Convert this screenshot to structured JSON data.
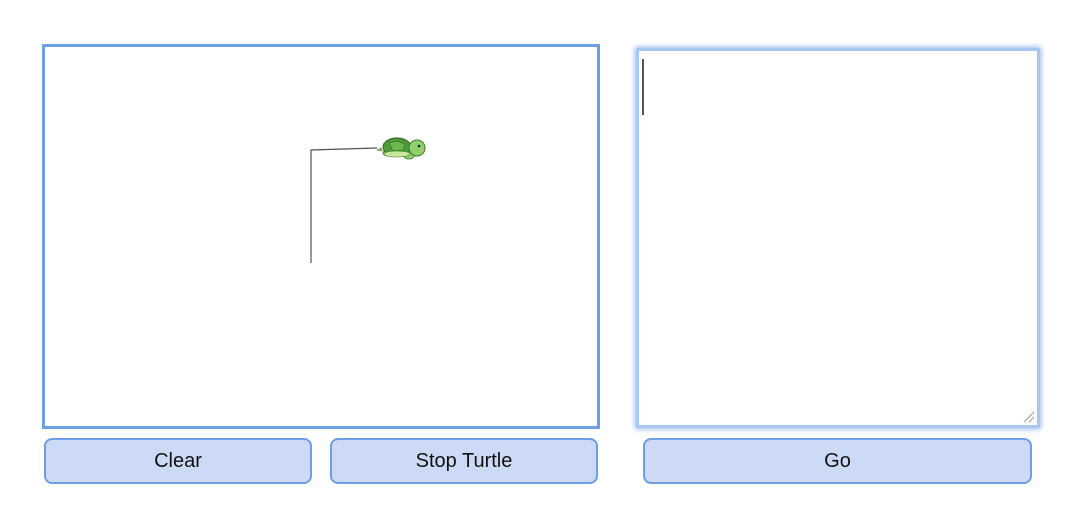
{
  "canvas": {
    "turtle_icon": "turtle-icon",
    "stroke_color": "#555555"
  },
  "editor": {
    "value": "",
    "placeholder": ""
  },
  "buttons": {
    "clear_label": "Clear",
    "stop_label": "Stop Turtle",
    "go_label": "Go"
  },
  "colors": {
    "accent_border": "#6e9ee3",
    "button_fill": "#ccdaf5",
    "editor_border": "#a8c6f0",
    "turtle_shell": "#4f9a3c",
    "turtle_body": "#8fd16a"
  }
}
